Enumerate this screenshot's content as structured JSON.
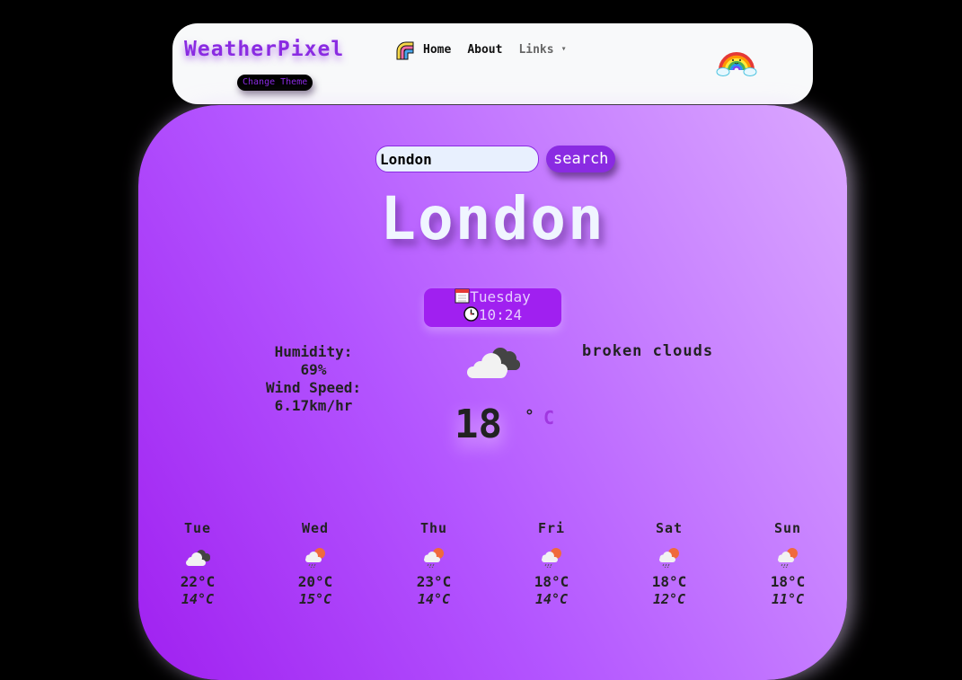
{
  "navbar": {
    "brand": "WeatherPixel",
    "links": [
      {
        "label": "Home"
      },
      {
        "label": "About"
      },
      {
        "label": "Links"
      }
    ],
    "links_caret": "▾",
    "theme_button": "Change Theme",
    "icons": {
      "nav_icon": "rainbow-arc-icon",
      "decoration": "rainbow-clouds-icon"
    }
  },
  "search": {
    "value": "London",
    "placeholder": "",
    "button_label": "search"
  },
  "current": {
    "city": "London",
    "day": "Tuesday",
    "time": "10:24",
    "day_icon": "calendar-icon",
    "time_icon": "clock-icon",
    "humidity_label": "Humidity:",
    "humidity_value": "69%",
    "wind_label": "Wind Speed:",
    "wind_value": "6.17km/hr",
    "temperature": "18",
    "degree_symbol": "°",
    "unit": "C",
    "description": "broken clouds",
    "icon": "broken-clouds-icon"
  },
  "forecast": [
    {
      "day": "Tue",
      "max": "22°C",
      "min": "14°C",
      "icon": "broken-clouds-icon"
    },
    {
      "day": "Wed",
      "max": "20°C",
      "min": "15°C",
      "icon": "sun-rain-cloud-icon"
    },
    {
      "day": "Thu",
      "max": "23°C",
      "min": "14°C",
      "icon": "sun-rain-cloud-icon"
    },
    {
      "day": "Fri",
      "max": "18°C",
      "min": "14°C",
      "icon": "sun-rain-cloud-icon"
    },
    {
      "day": "Sat",
      "max": "18°C",
      "min": "12°C",
      "icon": "sun-rain-cloud-icon"
    },
    {
      "day": "Sun",
      "max": "18°C",
      "min": "11°C",
      "icon": "sun-rain-cloud-icon"
    }
  ],
  "colors": {
    "brand": "#8a2be2",
    "card_start": "#a020f0",
    "card_end": "#dba8ff",
    "navbar_bg": "#f8f9fa",
    "page_bg": "#000000"
  }
}
